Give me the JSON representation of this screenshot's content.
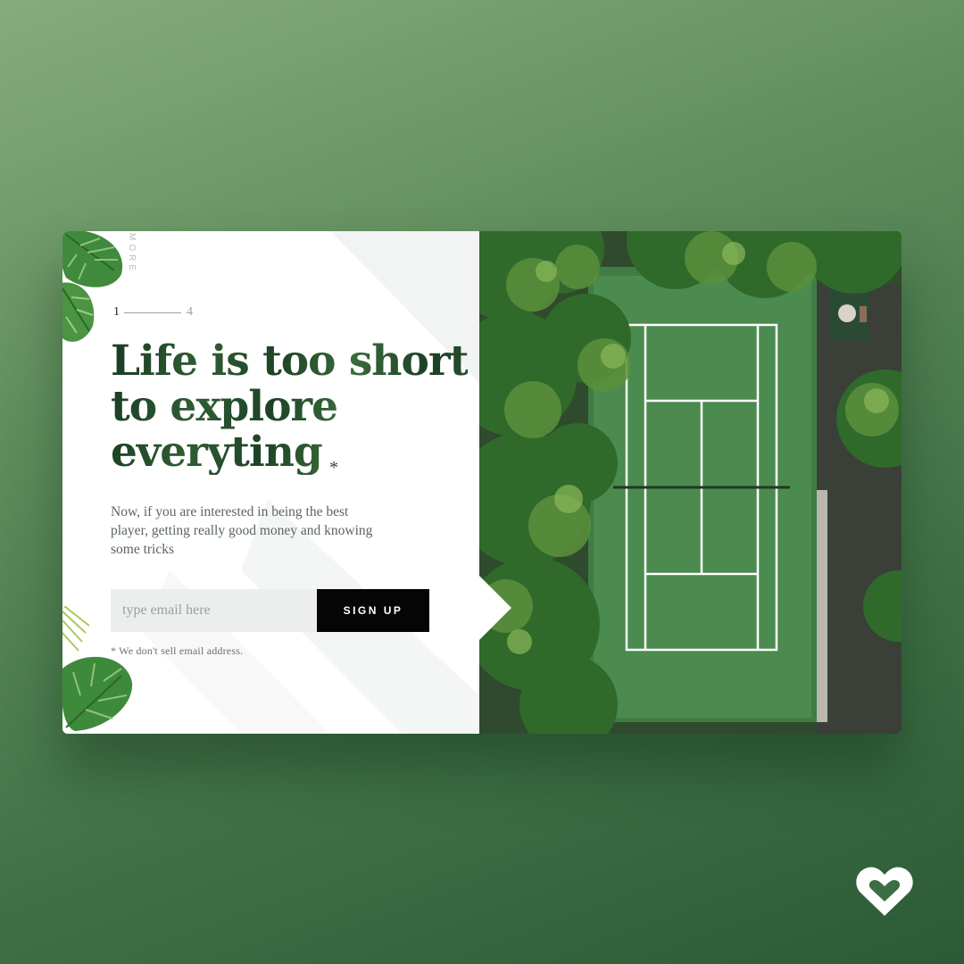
{
  "sidebar": {
    "more_label": "MORE"
  },
  "pager": {
    "current": "1",
    "total": "4"
  },
  "hero": {
    "headline_lines": [
      "Life is too short",
      "to explore",
      "everyting"
    ],
    "asterisk": "*",
    "description": "Now, if you are interested in being the best player, getting really good money and knowing some tricks"
  },
  "signup_form": {
    "email_placeholder": "type email here",
    "email_value": "",
    "button_label": "SIGN UP",
    "disclaimer": "* We don't sell email address."
  },
  "image": {
    "subject": "aerial tennis court surrounded by trees"
  },
  "brand": {
    "logo_icon": "heart-logo-icon"
  },
  "colors": {
    "background": "#5f8c5c",
    "headline": "#1f4a2a",
    "button": "#050505",
    "input": "#ebeeec",
    "court": "#3f7d45"
  }
}
